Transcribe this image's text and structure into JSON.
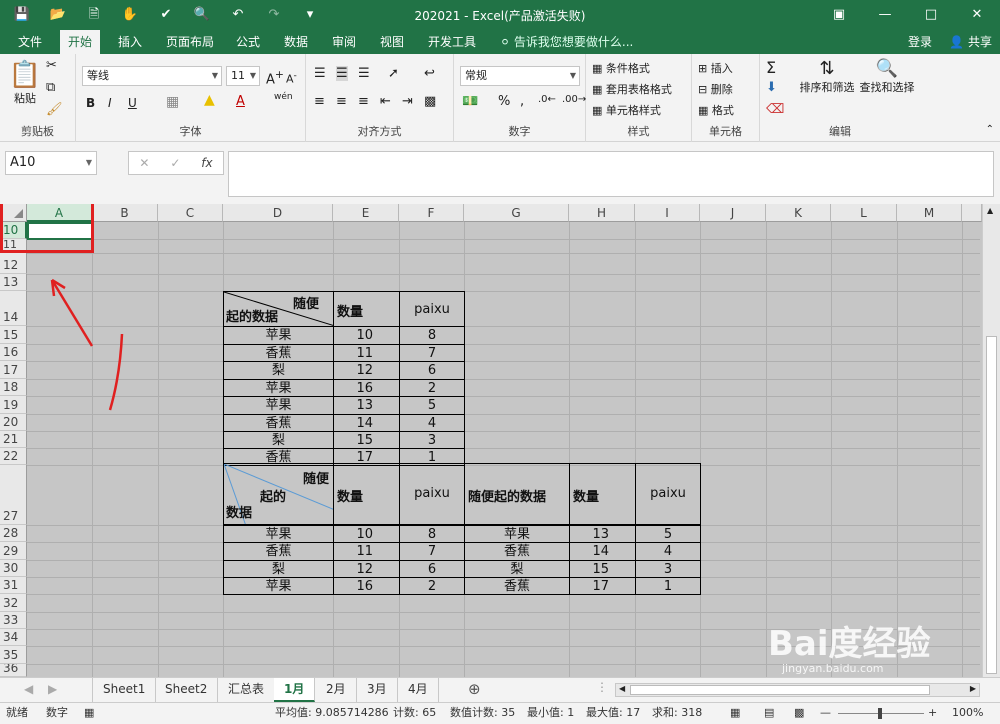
{
  "window": {
    "title": "202021 - Excel(产品激活失败)"
  },
  "ribbon_tabs": [
    "文件",
    "开始",
    "插入",
    "页面布局",
    "公式",
    "数据",
    "审阅",
    "视图",
    "开发工具"
  ],
  "tell_me": "告诉我您想要做什么...",
  "account": {
    "login": "登录",
    "share": "共享"
  },
  "clipboard": {
    "paste": "粘贴",
    "label": "剪贴板"
  },
  "font": {
    "name": "等线",
    "size": "11",
    "bold": "B",
    "italic": "I",
    "underline": "U",
    "label": "字体",
    "wen": "wén"
  },
  "alignment": {
    "label": "对齐方式"
  },
  "number": {
    "format": "常规",
    "label": "数字",
    "percent": "%"
  },
  "styles": {
    "conditional": "条件格式",
    "table": "套用表格格式",
    "cell": "单元格样式",
    "label": "样式"
  },
  "cells": {
    "insert": "插入",
    "delete": "删除",
    "format": "格式",
    "label": "单元格"
  },
  "editing": {
    "sort": "排序和筛选",
    "find": "查找和选择",
    "label": "编辑"
  },
  "formula_bar": {
    "name_box": "A10",
    "fx": "fx",
    "value": ""
  },
  "columns": [
    "A",
    "B",
    "C",
    "D",
    "E",
    "F",
    "G",
    "H",
    "I",
    "J",
    "K",
    "L",
    "M"
  ],
  "rows": [
    "10",
    "11",
    "12",
    "13",
    "14",
    "15",
    "16",
    "17",
    "18",
    "19",
    "20",
    "21",
    "22",
    "27",
    "28",
    "29",
    "30",
    "31",
    "32",
    "33",
    "34",
    "35",
    "36"
  ],
  "table1": {
    "header_top": "随便",
    "header_bottom": "起的数据",
    "col_qty": "数量",
    "col_rank": "paixu",
    "rows": [
      [
        "苹果",
        "10",
        "8"
      ],
      [
        "香蕉",
        "11",
        "7"
      ],
      [
        "梨",
        "12",
        "6"
      ],
      [
        "苹果",
        "16",
        "2"
      ],
      [
        "苹果",
        "13",
        "5"
      ],
      [
        "香蕉",
        "14",
        "4"
      ],
      [
        "梨",
        "15",
        "3"
      ],
      [
        "香蕉",
        "17",
        "1"
      ]
    ]
  },
  "table2": {
    "header_a": "随便",
    "header_b": "起的",
    "header_c": "数据",
    "col_qty": "数量",
    "col_rank": "paixu",
    "col_data2": "随便起的数据",
    "col_qty2": "数量",
    "col_rank2": "paixu",
    "rows": [
      [
        "苹果",
        "10",
        "8",
        "苹果",
        "13",
        "5"
      ],
      [
        "香蕉",
        "11",
        "7",
        "香蕉",
        "14",
        "4"
      ],
      [
        "梨",
        "12",
        "6",
        "梨",
        "15",
        "3"
      ],
      [
        "苹果",
        "16",
        "2",
        "香蕉",
        "17",
        "1"
      ]
    ]
  },
  "sheets": [
    "Sheet1",
    "Sheet2",
    "汇总表",
    "1月",
    "2月",
    "3月",
    "4月"
  ],
  "active_sheet": "1月",
  "status": {
    "ready": "就绪",
    "mode": "数字",
    "average": "平均值: 9.085714286",
    "count": "计数: 65",
    "num_count": "数值计数: 35",
    "min": "最小值: 1",
    "max": "最大值: 17",
    "sum": "求和: 318",
    "zoom": "100%"
  },
  "watermark": {
    "brand": "Bai度经验",
    "url": "jingyan.baidu.com"
  },
  "colors": {
    "accent": "#217346",
    "annotation": "#e02020"
  }
}
